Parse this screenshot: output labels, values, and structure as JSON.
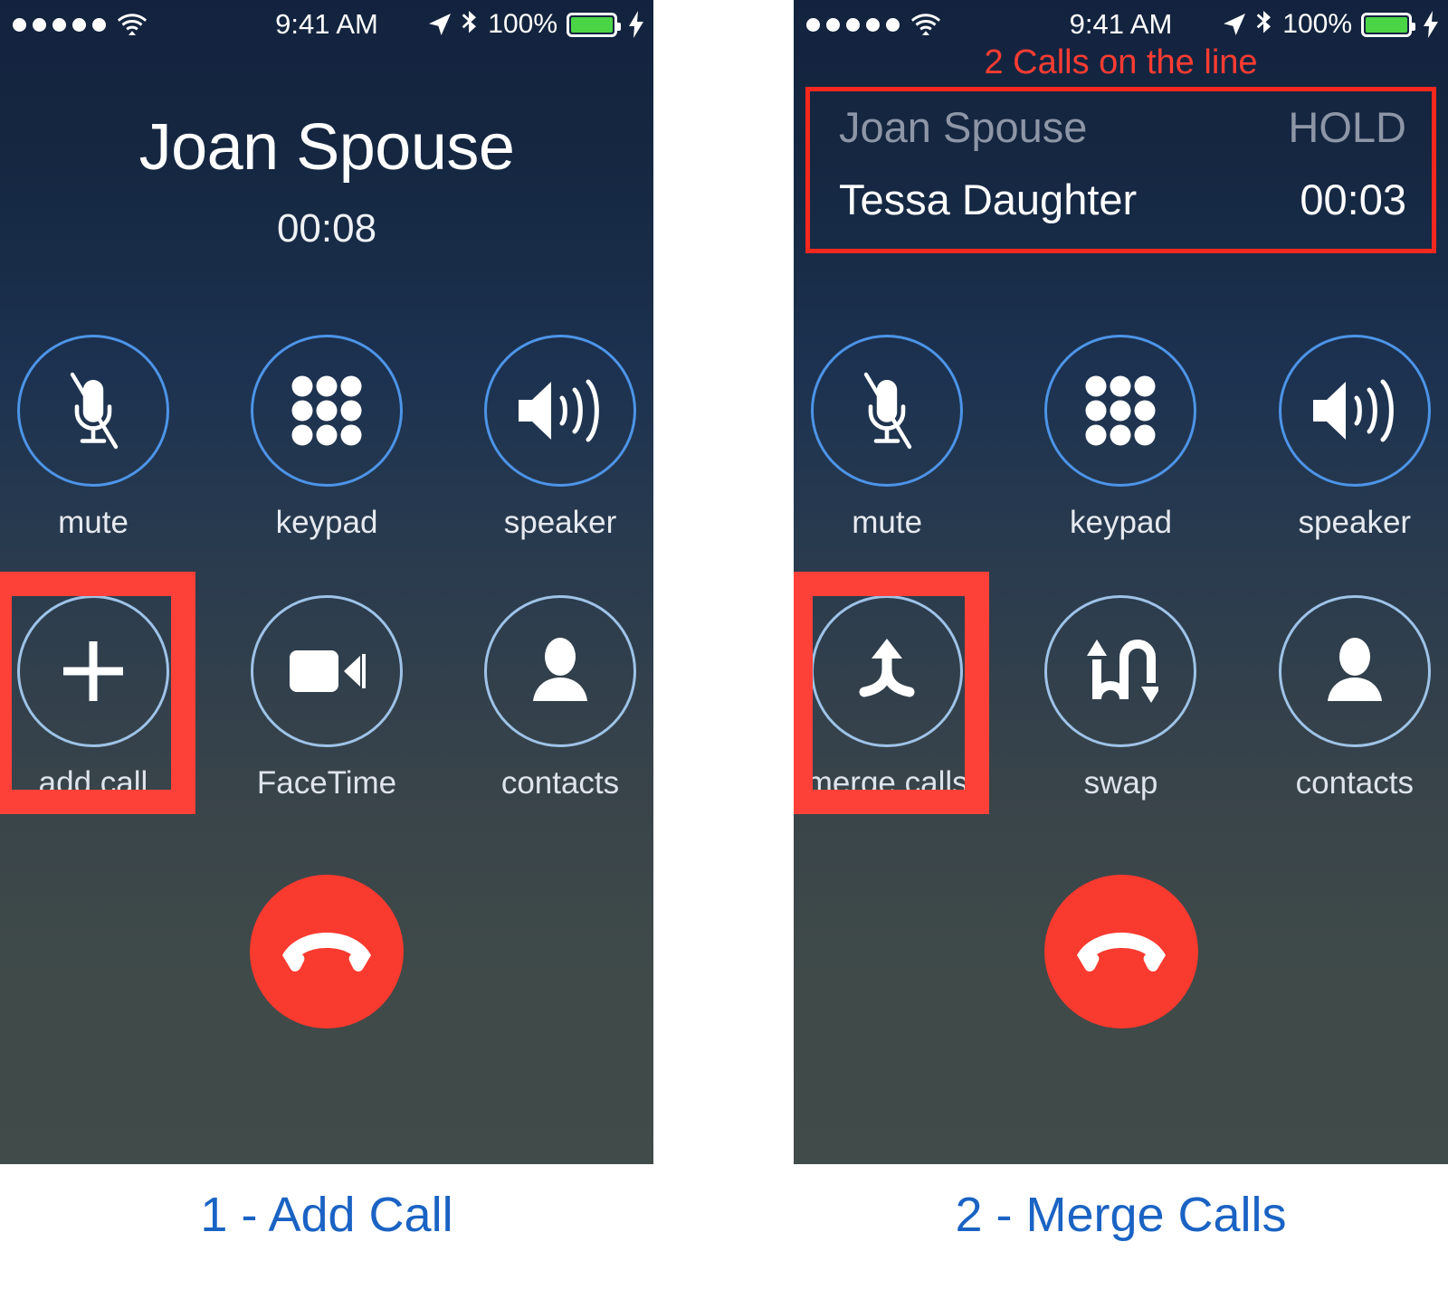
{
  "colors": {
    "accent_blue": "#1a63c4",
    "highlight_red": "#fd4138",
    "banner_red": "#ff3c32",
    "end_call_red": "#f93a2f",
    "battery_green": "#4cd447",
    "ring_blue": "#4d94e8",
    "ring_light": "#9fc3e8",
    "hold_gray": "#8d96a7"
  },
  "status_bar": {
    "signal_dots": 5,
    "wifi_icon": "wifi-icon",
    "time": "9:41 AM",
    "location_icon": "location-arrow-icon",
    "bluetooth_icon": "bluetooth-icon",
    "battery_percent": "100%",
    "battery_icon": "battery-full-icon",
    "charging_icon": "lightning-bolt-icon"
  },
  "panel1": {
    "caller_name": "Joan Spouse",
    "call_timer": "00:08",
    "buttons": [
      {
        "label": "mute",
        "icon": "microphone-muted-icon",
        "highlighted": false
      },
      {
        "label": "keypad",
        "icon": "keypad-dots-icon",
        "highlighted": false
      },
      {
        "label": "speaker",
        "icon": "speaker-waves-icon",
        "highlighted": false
      },
      {
        "label": "add call",
        "icon": "plus-icon",
        "highlighted": true
      },
      {
        "label": "FaceTime",
        "icon": "video-camera-icon",
        "highlighted": false
      },
      {
        "label": "contacts",
        "icon": "person-silhouette-icon",
        "highlighted": false
      }
    ],
    "end_call_icon": "hang-up-handset-icon",
    "caption": "1 - Add Call"
  },
  "panel2": {
    "banner": "2 Calls on the line",
    "calls": [
      {
        "name": "Joan Spouse",
        "status": "HOLD"
      },
      {
        "name": "Tessa Daughter",
        "status": "00:03"
      }
    ],
    "buttons": [
      {
        "label": "mute",
        "icon": "microphone-muted-icon",
        "highlighted": false
      },
      {
        "label": "keypad",
        "icon": "keypad-dots-icon",
        "highlighted": false
      },
      {
        "label": "speaker",
        "icon": "speaker-waves-icon",
        "highlighted": false
      },
      {
        "label": "merge calls",
        "icon": "merge-arrow-icon",
        "highlighted": true
      },
      {
        "label": "swap",
        "icon": "swap-arrows-icon",
        "highlighted": false
      },
      {
        "label": "contacts",
        "icon": "person-silhouette-icon",
        "highlighted": false
      }
    ],
    "end_call_icon": "hang-up-handset-icon",
    "caption": "2 - Merge Calls"
  }
}
